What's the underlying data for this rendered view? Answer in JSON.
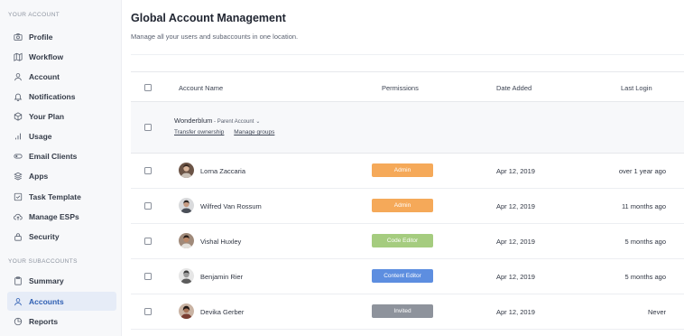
{
  "sidebar": {
    "section_account": "YOUR ACCOUNT",
    "section_subaccounts": "YOUR SUBACCOUNTS",
    "account_items": [
      {
        "label": "Profile",
        "icon": "camera-icon"
      },
      {
        "label": "Workflow",
        "icon": "map-icon"
      },
      {
        "label": "Account",
        "icon": "user-icon"
      },
      {
        "label": "Notifications",
        "icon": "bell-icon"
      },
      {
        "label": "Your Plan",
        "icon": "box-icon"
      },
      {
        "label": "Usage",
        "icon": "bar-chart-icon"
      },
      {
        "label": "Email Clients",
        "icon": "toggle-icon"
      },
      {
        "label": "Apps",
        "icon": "layers-icon"
      },
      {
        "label": "Task Template",
        "icon": "checkbox-icon"
      },
      {
        "label": "Manage ESPs",
        "icon": "cloud-upload-icon"
      },
      {
        "label": "Security",
        "icon": "lock-icon"
      }
    ],
    "subaccount_items": [
      {
        "label": "Summary",
        "icon": "clipboard-icon"
      },
      {
        "label": "Accounts",
        "icon": "user-icon",
        "active": true
      },
      {
        "label": "Reports",
        "icon": "pie-chart-icon"
      }
    ]
  },
  "main": {
    "title": "Global Account Management",
    "subtitle": "Manage all your users and subaccounts in one location."
  },
  "table": {
    "headers": {
      "name": "Account Name",
      "permissions": "Permissions",
      "date": "Date Added",
      "login": "Last Login"
    },
    "parent": {
      "name": "Wonderblum",
      "tag": " - Parent Account",
      "transfer": "Transfer ownership",
      "manage": "Manage groups"
    },
    "rows": [
      {
        "name": "Lorna Zaccaria",
        "permission": "Admin",
        "perm_color": "#f5a959",
        "date": "Apr 12, 2019",
        "login": "over 1 year ago"
      },
      {
        "name": "Wilfred Van Rossum",
        "permission": "Admin",
        "perm_color": "#f5a959",
        "date": "Apr 12, 2019",
        "login": "11 months ago"
      },
      {
        "name": "Vishal Huxley",
        "permission": "Code Editor",
        "perm_color": "#a5cc7f",
        "date": "Apr 12, 2019",
        "login": "5 months ago"
      },
      {
        "name": "Benjamin Rier",
        "permission": "Content Editor",
        "perm_color": "#5d8ee0",
        "date": "Apr 12, 2019",
        "login": "5 months ago"
      },
      {
        "name": "Devika Gerber",
        "permission": "Invited",
        "perm_color": "#8e939c",
        "date": "Apr 12, 2019",
        "login": "Never"
      }
    ]
  }
}
